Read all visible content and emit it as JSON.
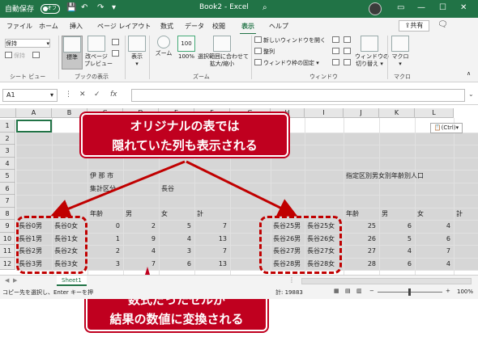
{
  "titlebar": {
    "autosave": "自動保存",
    "toggle": "オフ",
    "title": "Book2 - Excel",
    "search_icon": "magnifier-icon",
    "minimize": "—",
    "maximize": "☐",
    "close": "✕"
  },
  "tabs": [
    "ファイル",
    "ホーム",
    "挿入",
    "ページ レイアウト",
    "数式",
    "データ",
    "校閲",
    "表示",
    "ヘルプ"
  ],
  "active_tab": "表示",
  "share": "共有",
  "ribbon": {
    "sheet_view_label": "シート ビュー",
    "keep": "保持",
    "book_view": {
      "normal": "標準",
      "pagebreak": "改ページ\nプレビュー",
      "group": "ブックの表示"
    },
    "show": "表示",
    "zoom": {
      "zoom": "ズーム",
      "hundred": "100%",
      "fit": "選択範囲に合わせて\n拡大/縮小",
      "group": "ズーム"
    },
    "window": {
      "new": "新しいウィンドウを開く",
      "arrange": "整列",
      "freeze": "ウィンドウ枠の固定",
      "switch": "ウィンドウの\n切り替え",
      "group": "ウィンドウ"
    },
    "macro": {
      "label": "マクロ",
      "group": "マクロ"
    }
  },
  "formula_bar": {
    "name_box": "A1",
    "fx": "fx"
  },
  "columns": [
    "A",
    "B",
    "C",
    "D",
    "E",
    "F",
    "G",
    "H",
    "I",
    "J",
    "K",
    "L"
  ],
  "rows": [
    "1",
    "2",
    "3",
    "4",
    "5",
    "6",
    "7",
    "8",
    "9",
    "10",
    "11",
    "12"
  ],
  "cells": {
    "c5": "伊 那 市",
    "c6": "集計区分",
    "e6": "長谷",
    "j5": "指定区別男女別年齢別人口",
    "c8": "年齢",
    "d8": "男",
    "e8": "女",
    "f8": "計",
    "j8": "年齢",
    "k8": "男",
    "l8": "女",
    "m8": "計",
    "a9": "長谷0男",
    "a10": "長谷1男",
    "a11": "長谷2男",
    "a12": "長谷3男",
    "b9": "長谷0女",
    "b10": "長谷1女",
    "b11": "長谷2女",
    "b12": "長谷3女",
    "c9": "0",
    "c10": "1",
    "c11": "2",
    "c12": "3",
    "d9": "2",
    "d10": "9",
    "d11": "4",
    "d12": "7",
    "e9": "5",
    "e10": "4",
    "e11": "3",
    "e12": "6",
    "f9": "7",
    "f10": "13",
    "f11": "7",
    "f12": "13",
    "h9": "長谷25男",
    "h10": "長谷26男",
    "h11": "長谷27男",
    "h12": "長谷28男",
    "i9": "長谷25女",
    "i10": "長谷26女",
    "i11": "長谷27女",
    "i12": "長谷28女",
    "j9": "25",
    "j10": "26",
    "j11": "27",
    "j12": "28",
    "k9": "6",
    "k10": "5",
    "k11": "4",
    "k12": "6",
    "l9": "4",
    "l10": "6",
    "l11": "7",
    "l12": "4"
  },
  "ctrl_tag": "(Ctrl)",
  "callouts": {
    "top_line1": "オリジナルの表では",
    "top_line2": "隠れていた列も表示される",
    "bottom_line1": "数式だったセルが",
    "bottom_line2": "結果の数値に変換される"
  },
  "sheet_tab": "Sheet1",
  "status": {
    "left": "コピー先を選択し、Enter キーを押",
    "sum": "計: 19883",
    "zoom": "100%"
  },
  "colors": {
    "excel_green": "#217346",
    "callout_red": "#c0001f",
    "dash_red": "#c00000"
  }
}
